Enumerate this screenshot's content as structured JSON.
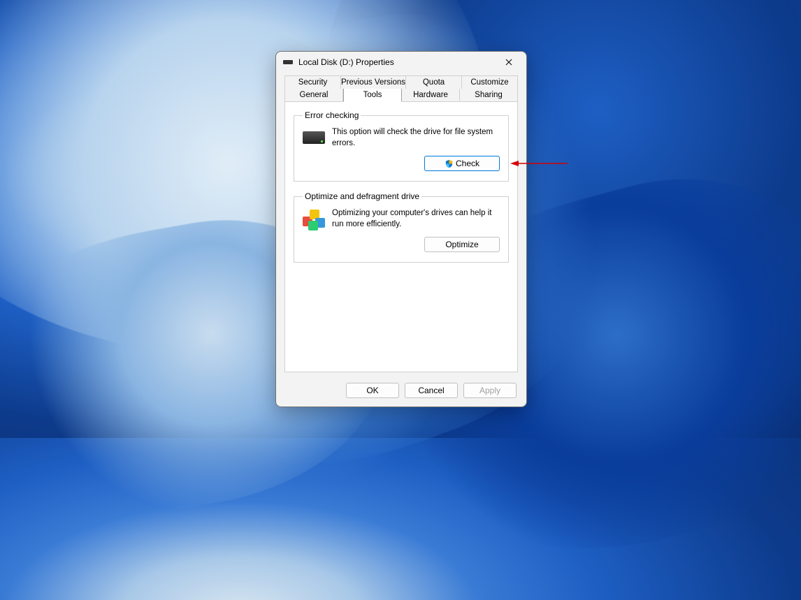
{
  "window": {
    "title": "Local Disk (D:) Properties"
  },
  "tabs": {
    "row1": [
      {
        "label": "Security"
      },
      {
        "label": "Previous Versions"
      },
      {
        "label": "Quota"
      },
      {
        "label": "Customize"
      }
    ],
    "row2": [
      {
        "label": "General"
      },
      {
        "label": "Tools",
        "active": true
      },
      {
        "label": "Hardware"
      },
      {
        "label": "Sharing"
      }
    ]
  },
  "groups": {
    "errorChecking": {
      "legend": "Error checking",
      "description": "This option will check the drive for file system errors.",
      "button": "Check"
    },
    "optimize": {
      "legend": "Optimize and defragment drive",
      "description": "Optimizing your computer's drives can help it run more efficiently.",
      "button": "Optimize"
    }
  },
  "buttons": {
    "ok": "OK",
    "cancel": "Cancel",
    "apply": "Apply"
  }
}
